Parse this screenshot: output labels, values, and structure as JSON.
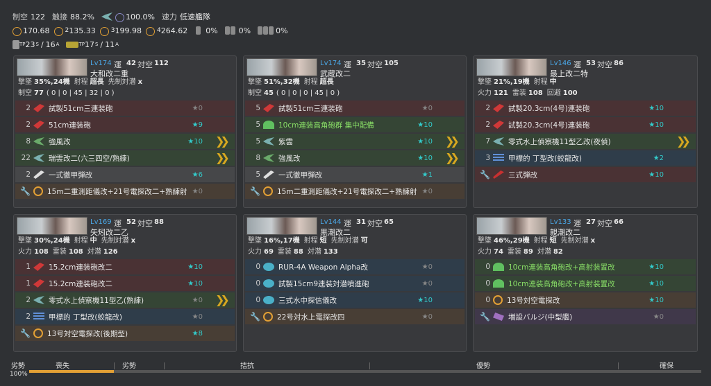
{
  "summary": {
    "air_label": "制空",
    "air_value": "122",
    "contact_label": "触接",
    "contact_value": "88.2%",
    "los_value": "100.0%",
    "speed_label": "速力",
    "speed_value": "低速艦隊",
    "los": [
      {
        "idx": "",
        "value": "170.68"
      },
      {
        "idx": "2",
        "value": "135.33"
      },
      {
        "idx": "3",
        "value": "199.98"
      },
      {
        "idx": "4",
        "value": "264.62"
      }
    ],
    "drum1": "0%",
    "drum2": "0%",
    "drum3": "0%",
    "tp1_value": "23",
    "tp1_s": "S",
    "tp1_a_value": "16",
    "tp1_a": "A",
    "tp2_value": "17",
    "tp2_s": "S",
    "tp2_a_value": "11",
    "tp2_a": "A",
    "tp_sub": "TP"
  },
  "ships": [
    {
      "level": "Lv174",
      "luck_label": "運",
      "luck": "42",
      "aa_label": "対空",
      "aa": "112",
      "name": "大和改二重",
      "line1": [
        {
          "k": "撃墜",
          "v": "35%,24機"
        },
        {
          "k": "射程",
          "v": "超長"
        },
        {
          "k": "先制対潜",
          "v": "x"
        }
      ],
      "line2": [
        {
          "k": "制空",
          "v": "77"
        },
        {
          "k": "",
          "v": "( 0 | 0 | 45 | 32 | 0 )"
        }
      ],
      "slots": [
        {
          "cnt": "2",
          "name": "試製51cm三連装砲",
          "star": "★0",
          "lit": false,
          "cls": "red",
          "icon": "ico-gun",
          "chev": false
        },
        {
          "cnt": "2",
          "name": "51cm連装砲",
          "star": "★9",
          "lit": true,
          "cls": "red",
          "icon": "ico-gun",
          "chev": false
        },
        {
          "cnt": "8",
          "name": "強風改",
          "star": "★10",
          "lit": true,
          "cls": "green",
          "icon": "ico-fighter",
          "chev": true
        },
        {
          "cnt": "22",
          "name": "瑞雲改二(六三四空/熟練)",
          "star": "",
          "lit": false,
          "cls": "green",
          "icon": "ico-seaplane",
          "chev": true
        },
        {
          "cnt": "2",
          "name": "一式徹甲弾改",
          "star": "★6",
          "lit": true,
          "cls": "gray",
          "icon": "ico-shell",
          "chev": false
        },
        {
          "cnt": "",
          "name": "15m二重測距儀改+21号電探改二+熟練射",
          "star": "★0",
          "lit": false,
          "cls": "brown",
          "icon": "ico-radar",
          "chev": false,
          "wrench": true
        }
      ]
    },
    {
      "level": "Lv174",
      "luck_label": "運",
      "luck": "35",
      "aa_label": "対空",
      "aa": "105",
      "name": "武蔵改二",
      "line1": [
        {
          "k": "撃墜",
          "v": "51%,32機"
        },
        {
          "k": "射程",
          "v": "超長"
        }
      ],
      "line2": [
        {
          "k": "制空",
          "v": "45"
        },
        {
          "k": "",
          "v": "( 0 | 0 | 0 | 45 | 0 )"
        }
      ],
      "slots": [
        {
          "cnt": "5",
          "name": "試製51cm三連装砲",
          "star": "★0",
          "lit": false,
          "cls": "red",
          "icon": "ico-gun",
          "chev": false
        },
        {
          "cnt": "5",
          "name": "10cm連装高角砲群 集中配備",
          "star": "★10",
          "lit": true,
          "cls": "green",
          "icon": "ico-ltgun",
          "chev": false,
          "grn": true
        },
        {
          "cnt": "5",
          "name": "紫雲",
          "star": "★10",
          "lit": true,
          "cls": "green",
          "icon": "ico-seaplane",
          "chev": true
        },
        {
          "cnt": "8",
          "name": "強風改",
          "star": "★10",
          "lit": true,
          "cls": "green",
          "icon": "ico-fighter",
          "chev": true
        },
        {
          "cnt": "5",
          "name": "一式徹甲弾改",
          "star": "★1",
          "lit": true,
          "cls": "gray",
          "icon": "ico-shell",
          "chev": false
        },
        {
          "cnt": "",
          "name": "15m二重測距儀改+21号電探改二+熟練射",
          "star": "★0",
          "lit": false,
          "cls": "brown",
          "icon": "ico-radar",
          "chev": false,
          "wrench": true
        }
      ]
    },
    {
      "level": "Lv146",
      "luck_label": "運",
      "luck": "53",
      "aa_label": "対空",
      "aa": "86",
      "name": "最上改二特",
      "line1": [
        {
          "k": "撃墜",
          "v": "21%,19機"
        },
        {
          "k": "射程",
          "v": "中"
        }
      ],
      "line2": [
        {
          "k": "火力",
          "v": "121"
        },
        {
          "k": "雷装",
          "v": "108"
        },
        {
          "k": "回避",
          "v": "100"
        }
      ],
      "slots": [
        {
          "cnt": "2",
          "name": "試製20.3cm(4号)連装砲",
          "star": "★10",
          "lit": true,
          "cls": "red",
          "icon": "ico-gun",
          "chev": false
        },
        {
          "cnt": "2",
          "name": "試製20.3cm(4号)連装砲",
          "star": "★10",
          "lit": true,
          "cls": "red",
          "icon": "ico-gun",
          "chev": false
        },
        {
          "cnt": "7",
          "name": "零式水上偵察機11型乙改(夜偵)",
          "star": "",
          "lit": false,
          "cls": "green",
          "icon": "ico-seaplane",
          "chev": true
        },
        {
          "cnt": "3",
          "name": "甲標的 丁型改(蛟龍改)",
          "star": "★2",
          "lit": true,
          "cls": "blue",
          "icon": "ico-bars",
          "chev": false
        },
        {
          "cnt": "",
          "name": "三式弾改",
          "star": "★10",
          "lit": true,
          "cls": "red",
          "icon": "ico-aa-shell",
          "chev": false,
          "wrench": true
        }
      ]
    },
    {
      "level": "Lv169",
      "luck_label": "運",
      "luck": "52",
      "aa_label": "対空",
      "aa": "88",
      "name": "矢矧改二乙",
      "line1": [
        {
          "k": "撃墜",
          "v": "30%,24機"
        },
        {
          "k": "射程",
          "v": "中"
        },
        {
          "k": "先制対潜",
          "v": "x"
        }
      ],
      "line2": [
        {
          "k": "火力",
          "v": "108"
        },
        {
          "k": "雷装",
          "v": "108"
        },
        {
          "k": "対潜",
          "v": "126"
        }
      ],
      "slots": [
        {
          "cnt": "1",
          "name": "15.2cm連装砲改二",
          "star": "★10",
          "lit": true,
          "cls": "red",
          "icon": "ico-gun",
          "chev": false
        },
        {
          "cnt": "1",
          "name": "15.2cm連装砲改二",
          "star": "★10",
          "lit": true,
          "cls": "red",
          "icon": "ico-gun",
          "chev": false
        },
        {
          "cnt": "2",
          "name": "零式水上偵察機11型乙(熟練)",
          "star": "★0",
          "lit": false,
          "cls": "green",
          "icon": "ico-seaplane",
          "chev": true
        },
        {
          "cnt": "2",
          "name": "甲標的 丁型改(蛟龍改)",
          "star": "★0",
          "lit": false,
          "cls": "blue",
          "icon": "ico-bars",
          "chev": false
        },
        {
          "cnt": "",
          "name": "13号対空電探改(後期型)",
          "star": "★8",
          "lit": true,
          "cls": "brown",
          "icon": "ico-radar",
          "chev": false,
          "wrench": true
        }
      ]
    },
    {
      "level": "Lv144",
      "luck_label": "運",
      "luck": "31",
      "aa_label": "対空",
      "aa": "65",
      "name": "黒潮改二",
      "line1": [
        {
          "k": "撃墜",
          "v": "16%,17機"
        },
        {
          "k": "射程",
          "v": "短"
        },
        {
          "k": "先制対潜",
          "v": "可"
        }
      ],
      "line2": [
        {
          "k": "火力",
          "v": "69"
        },
        {
          "k": "雷装",
          "v": "88"
        },
        {
          "k": "対潜",
          "v": "133"
        }
      ],
      "slots": [
        {
          "cnt": "0",
          "name": "RUR-4A Weapon Alpha改",
          "star": "★0",
          "lit": false,
          "cls": "blue",
          "icon": "ico-sonar",
          "chev": false
        },
        {
          "cnt": "0",
          "name": "試製15cm9連装対潜噴進砲",
          "star": "★0",
          "lit": false,
          "cls": "blue",
          "icon": "ico-sonar",
          "chev": false
        },
        {
          "cnt": "0",
          "name": "三式水中探信儀改",
          "star": "★10",
          "lit": true,
          "cls": "blue",
          "icon": "ico-sonar",
          "chev": false
        },
        {
          "cnt": "",
          "name": "22号対水上電探改四",
          "star": "★0",
          "lit": false,
          "cls": "brown",
          "icon": "ico-radar",
          "chev": false,
          "wrench": true
        }
      ]
    },
    {
      "level": "Lv133",
      "luck_label": "運",
      "luck": "27",
      "aa_label": "対空",
      "aa": "66",
      "name": "親潮改二",
      "line1": [
        {
          "k": "撃墜",
          "v": "46%,29機"
        },
        {
          "k": "射程",
          "v": "短"
        },
        {
          "k": "先制対潜",
          "v": "x"
        }
      ],
      "line2": [
        {
          "k": "火力",
          "v": "74"
        },
        {
          "k": "雷装",
          "v": "89"
        },
        {
          "k": "対潜",
          "v": "82"
        }
      ],
      "slots": [
        {
          "cnt": "0",
          "name": "10cm連装高角砲改+高射装置改",
          "star": "★10",
          "lit": true,
          "cls": "green",
          "icon": "ico-ltgun",
          "chev": false,
          "grn": true
        },
        {
          "cnt": "0",
          "name": "10cm連装高角砲改+高射装置改",
          "star": "★10",
          "lit": true,
          "cls": "green",
          "icon": "ico-ltgun",
          "chev": false,
          "grn": true
        },
        {
          "cnt": "0",
          "name": "13号対空電探改",
          "star": "★10",
          "lit": true,
          "cls": "brown",
          "icon": "ico-radar",
          "chev": false
        },
        {
          "cnt": "",
          "name": "増設バルジ(中型艦)",
          "star": "★0",
          "lit": false,
          "cls": "purple",
          "icon": "ico-bulge",
          "chev": false,
          "wrench": true
        }
      ]
    }
  ],
  "balance": {
    "left_label": "劣勢",
    "pct": "100%",
    "fill_fraction": 0.126,
    "marks": [
      "喪失",
      "劣勢",
      "拮抗",
      "優勢",
      "確保"
    ]
  },
  "colors": {
    "accent": "#e3a035",
    "level": "#4aa8e8",
    "star_lit": "#33cccc"
  }
}
